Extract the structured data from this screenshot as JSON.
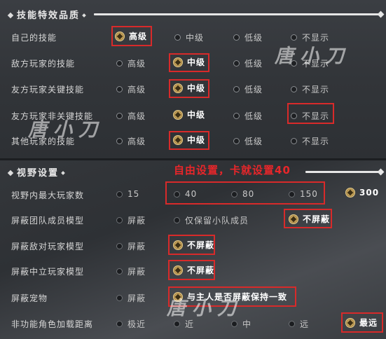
{
  "section1": {
    "title": "技能特效品质",
    "rows": [
      {
        "label": "自己的技能",
        "options": [
          "高级",
          "中级",
          "低级",
          "不显示"
        ],
        "selected": 0
      },
      {
        "label": "敌方玩家的技能",
        "options": [
          "高级",
          "中级",
          "低级",
          "不显示"
        ],
        "selected": 1
      },
      {
        "label": "友方玩家关键技能",
        "options": [
          "高级",
          "中级",
          "低级",
          "不显示"
        ],
        "selected": 1
      },
      {
        "label": "友方玩家非关键技能",
        "options": [
          "高级",
          "中级",
          "低级",
          "不显示"
        ],
        "selected": 1
      },
      {
        "label": "其他玩家的技能",
        "options": [
          "高级",
          "中级",
          "低级",
          "不显示"
        ],
        "selected": 1
      }
    ]
  },
  "section2": {
    "title": "视野设置",
    "annotation": "自由设置，卡就设置40",
    "max_players": {
      "label": "视野内最大玩家数",
      "options": [
        "15",
        "40",
        "80",
        "150",
        "300"
      ],
      "selected": 4
    },
    "team_model": {
      "label": "屏蔽团队成员模型",
      "options": [
        "屏蔽",
        "仅保留小队成员",
        "不屏蔽"
      ],
      "selected": 2
    },
    "enemy_model": {
      "label": "屏蔽敌对玩家模型",
      "options": [
        "屏蔽",
        "不屏蔽"
      ],
      "selected": 1
    },
    "neutral_model": {
      "label": "屏蔽中立玩家模型",
      "options": [
        "屏蔽",
        "不屏蔽"
      ],
      "selected": 1
    },
    "pet": {
      "label": "屏蔽宠物",
      "options": [
        "屏蔽",
        "与主人是否屏蔽保持一致"
      ],
      "selected": 1
    },
    "npc_distance": {
      "label": "非功能角色加载距离",
      "options": [
        "极近",
        "近",
        "中",
        "远",
        "最远"
      ],
      "selected": 4
    }
  },
  "watermark": "唐小刀",
  "colors": {
    "highlight_box": "#d82a2a",
    "annotation": "#e8262a",
    "selected_radio": "#c9a45a"
  }
}
